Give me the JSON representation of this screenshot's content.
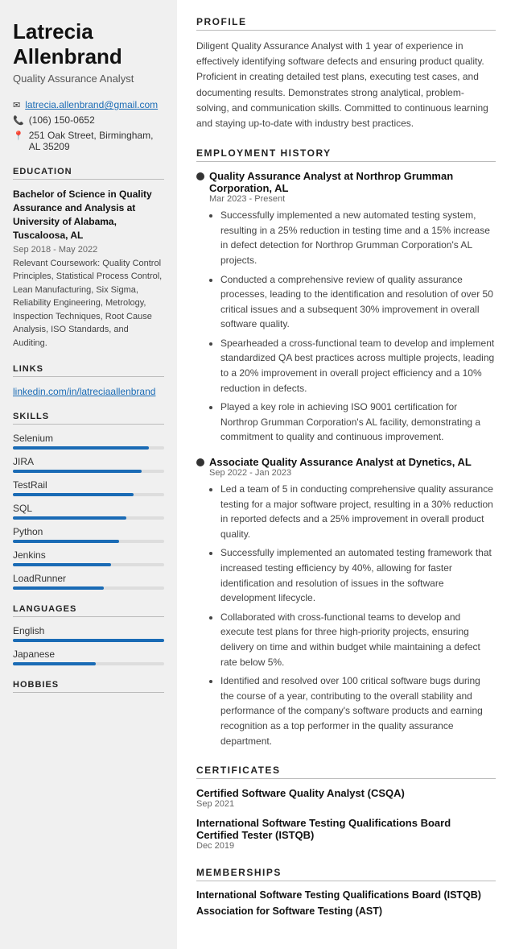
{
  "sidebar": {
    "name": "Latrecia Allenbrand",
    "title": "Quality Assurance Analyst",
    "contact": {
      "email": "latrecia.allenbrand@gmail.com",
      "phone": "(106) 150-0652",
      "address": "251 Oak Street, Birmingham, AL 35209"
    },
    "education": {
      "degree": "Bachelor of Science in Quality Assurance and Analysis at University of Alabama, Tuscaloosa, AL",
      "date": "Sep 2018 - May 2022",
      "coursework_label": "Relevant Coursework:",
      "coursework": "Quality Control Principles, Statistical Process Control, Lean Manufacturing, Six Sigma, Reliability Engineering, Metrology, Inspection Techniques, Root Cause Analysis, ISO Standards, and Auditing."
    },
    "links": [
      {
        "label": "linkedin.com/in/latreciaallenbrand",
        "url": "#"
      }
    ],
    "skills": [
      {
        "name": "Selenium",
        "percent": 90
      },
      {
        "name": "JIRA",
        "percent": 85
      },
      {
        "name": "TestRail",
        "percent": 80
      },
      {
        "name": "SQL",
        "percent": 75
      },
      {
        "name": "Python",
        "percent": 70
      },
      {
        "name": "Jenkins",
        "percent": 65
      },
      {
        "name": "LoadRunner",
        "percent": 60
      }
    ],
    "languages": [
      {
        "name": "English",
        "percent": 100
      },
      {
        "name": "Japanese",
        "percent": 55
      }
    ],
    "hobbies_section": "HOBBIES"
  },
  "main": {
    "profile": {
      "section_title": "PROFILE",
      "text": "Diligent Quality Assurance Analyst with 1 year of experience in effectively identifying software defects and ensuring product quality. Proficient in creating detailed test plans, executing test cases, and documenting results. Demonstrates strong analytical, problem-solving, and communication skills. Committed to continuous learning and staying up-to-date with industry best practices."
    },
    "employment": {
      "section_title": "EMPLOYMENT HISTORY",
      "jobs": [
        {
          "title": "Quality Assurance Analyst at Northrop Grumman Corporation, AL",
          "date": "Mar 2023 - Present",
          "bullets": [
            "Successfully implemented a new automated testing system, resulting in a 25% reduction in testing time and a 15% increase in defect detection for Northrop Grumman Corporation's AL projects.",
            "Conducted a comprehensive review of quality assurance processes, leading to the identification and resolution of over 50 critical issues and a subsequent 30% improvement in overall software quality.",
            "Spearheaded a cross-functional team to develop and implement standardized QA best practices across multiple projects, leading to a 20% improvement in overall project efficiency and a 10% reduction in defects.",
            "Played a key role in achieving ISO 9001 certification for Northrop Grumman Corporation's AL facility, demonstrating a commitment to quality and continuous improvement."
          ]
        },
        {
          "title": "Associate Quality Assurance Analyst at Dynetics, AL",
          "date": "Sep 2022 - Jan 2023",
          "bullets": [
            "Led a team of 5 in conducting comprehensive quality assurance testing for a major software project, resulting in a 30% reduction in reported defects and a 25% improvement in overall product quality.",
            "Successfully implemented an automated testing framework that increased testing efficiency by 40%, allowing for faster identification and resolution of issues in the software development lifecycle.",
            "Collaborated with cross-functional teams to develop and execute test plans for three high-priority projects, ensuring delivery on time and within budget while maintaining a defect rate below 5%.",
            "Identified and resolved over 100 critical software bugs during the course of a year, contributing to the overall stability and performance of the company's software products and earning recognition as a top performer in the quality assurance department."
          ]
        }
      ]
    },
    "certificates": {
      "section_title": "CERTIFICATES",
      "items": [
        {
          "name": "Certified Software Quality Analyst (CSQA)",
          "date": "Sep 2021"
        },
        {
          "name": "International Software Testing Qualifications Board Certified Tester (ISTQB)",
          "date": "Dec 2019"
        }
      ]
    },
    "memberships": {
      "section_title": "MEMBERSHIPS",
      "items": [
        "International Software Testing Qualifications Board (ISTQB)",
        "Association for Software Testing (AST)"
      ]
    }
  }
}
